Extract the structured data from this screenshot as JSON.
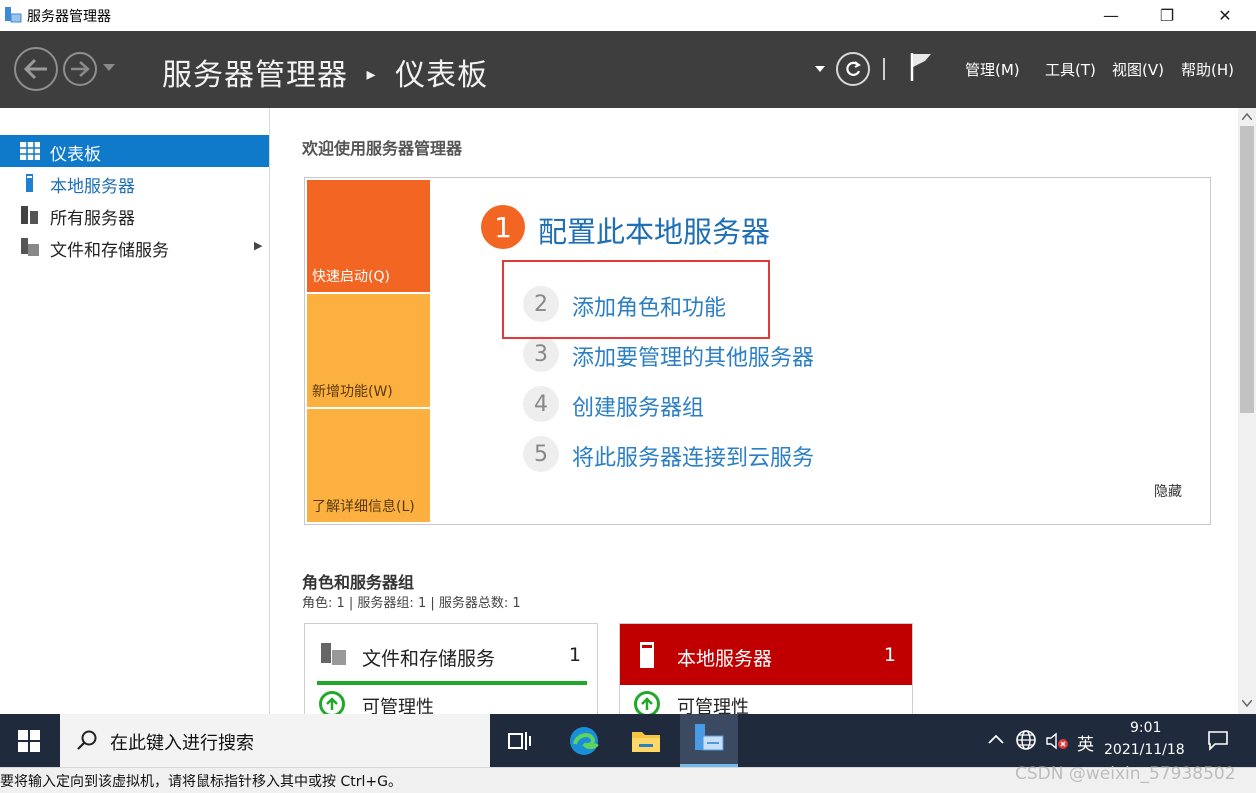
{
  "window": {
    "title": "服务器管理器",
    "minimize": "—",
    "restore": "❐",
    "close": "✕"
  },
  "header": {
    "app_name": "服务器管理器",
    "separator": "▸",
    "page": "仪表板",
    "menus": [
      "管理(M)",
      "工具(T)",
      "视图(V)",
      "帮助(H)"
    ]
  },
  "sidebar": {
    "items": [
      {
        "label": "仪表板",
        "icon": "dashboard-icon",
        "selected": true
      },
      {
        "label": "本地服务器",
        "icon": "server-icon",
        "selected": false
      },
      {
        "label": "所有服务器",
        "icon": "servers-icon",
        "selected": false
      },
      {
        "label": "文件和存储服务",
        "icon": "storage-icon",
        "selected": false
      }
    ],
    "expand_arrow": "▶"
  },
  "main": {
    "welcome": "欢迎使用服务器管理器",
    "tiles": [
      {
        "label": "快速启动(Q)",
        "color": "#f26522"
      },
      {
        "label": "新增功能(W)",
        "color": "#fbb040"
      },
      {
        "label": "了解详细信息(L)",
        "color": "#fbb040"
      }
    ],
    "main_step": {
      "num": "1",
      "label": "配置此本地服务器"
    },
    "steps": [
      {
        "num": "2",
        "label": "添加角色和功能"
      },
      {
        "num": "3",
        "label": "添加要管理的其他服务器"
      },
      {
        "num": "4",
        "label": "创建服务器组"
      },
      {
        "num": "5",
        "label": "将此服务器连接到云服务"
      }
    ],
    "hide": "隐藏",
    "roles_title": "角色和服务器组",
    "roles_summary": "角色: 1 | 服务器组: 1 | 服务器总数: 1",
    "cards": [
      {
        "title": "文件和存储服务",
        "count": "1",
        "status": "可管理性",
        "header_color": "#ffffff",
        "accent": "#22a829"
      },
      {
        "title": "本地服务器",
        "count": "1",
        "status": "可管理性",
        "header_color": "#c00000",
        "accent": "#c00000"
      }
    ]
  },
  "taskbar": {
    "search_placeholder": "在此键入进行搜索",
    "ime": "英",
    "time": "9:01",
    "date": "2021/11/18"
  },
  "statusbar": {
    "text": "要将输入定向到该虚拟机，请将鼠标指针移入其中或按 Ctrl+G。",
    "watermark": "CSDN @weixin_57938502"
  },
  "colors": {
    "accent_blue": "#0078d7",
    "link_blue": "#2b7fc4",
    "header_bg": "#3e3e3e"
  }
}
